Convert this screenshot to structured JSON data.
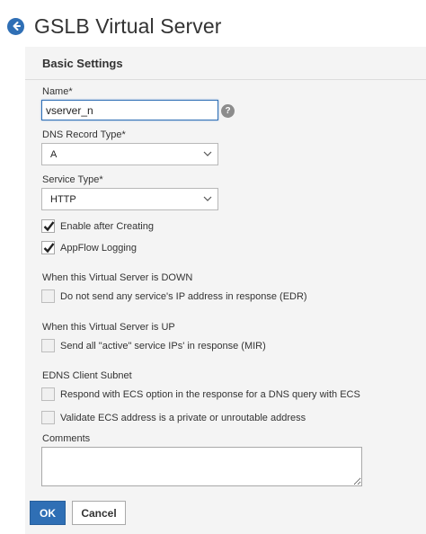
{
  "header": {
    "title": "GSLB Virtual Server",
    "back_icon": "back-arrow-icon"
  },
  "panel": {
    "section_title": "Basic Settings",
    "name": {
      "label": "Name*",
      "value": "vserver_n"
    },
    "dns_record_type": {
      "label": "DNS Record Type*",
      "value": "A"
    },
    "service_type": {
      "label": "Service Type*",
      "value": "HTTP"
    },
    "enable_after_creating": {
      "label": "Enable after Creating",
      "checked": true
    },
    "appflow_logging": {
      "label": "AppFlow Logging",
      "checked": true
    },
    "down_section": {
      "heading": "When this Virtual Server is DOWN",
      "edr": {
        "label": "Do not send any service's IP address in response (EDR)",
        "checked": false
      }
    },
    "up_section": {
      "heading": "When this Virtual Server is UP",
      "mir": {
        "label": "Send all \"active\" service IPs' in response (MIR)",
        "checked": false
      }
    },
    "edns_section": {
      "heading": "EDNS Client Subnet",
      "ecs_respond": {
        "label": "Respond with ECS option in the response for a DNS query with ECS",
        "checked": false
      },
      "ecs_validate": {
        "label": "Validate ECS address is a private or unroutable address",
        "checked": false
      }
    },
    "comments": {
      "label": "Comments",
      "value": ""
    }
  },
  "buttons": {
    "ok": "OK",
    "cancel": "Cancel"
  },
  "colors": {
    "accent": "#2f6fb5"
  }
}
